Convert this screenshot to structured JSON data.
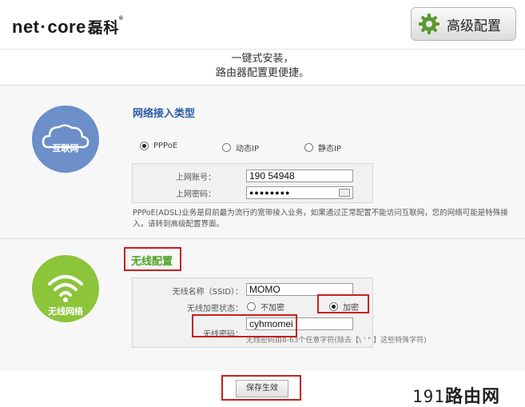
{
  "header": {
    "brand_en": "net",
    "brand_dot": "·",
    "brand_en2": "core",
    "brand_cn": "磊科",
    "brand_reg": "®",
    "advanced_label": "高级配置"
  },
  "slogan": {
    "line1": "一键式安装，",
    "line2": "路由器配置更便捷。"
  },
  "internet": {
    "icon_label": "互联网",
    "title": "网络接入类型",
    "options": [
      "PPPoE",
      "动态IP",
      "静态IP"
    ],
    "selected": "PPPoE",
    "account_label": "上网账号：",
    "account_value": "190     54948",
    "password_label": "上网密码：",
    "password_value": "●●●●●●●●",
    "description": "PPPoE(ADSL)业务是目前最为流行的宽带接入业务，如果通过正常配置不能访问互联网，您的网络可能是特殊接入，请转到高级配置界面。"
  },
  "wireless": {
    "icon_label": "无线网络",
    "title": "无线配置",
    "ssid_label": "无线名称（SSID）：",
    "ssid_value": "MOMO",
    "encrypt_label": "无线加密状态：",
    "enc_options": [
      "不加密",
      "加密"
    ],
    "enc_selected": "加密",
    "password_label": "无线密码：",
    "password_value": "cyhmomei",
    "password_hint": "无线密码由8-63个任意字符(除去【\\ ' \" 】这些特殊字符)"
  },
  "footer": {
    "save_label": "保存生效",
    "watermark_num": "191",
    "watermark_text": "路由网"
  },
  "colors": {
    "internet_circle": "#6c8fc9",
    "wireless_circle": "#8cc43a",
    "highlight": "#c81e1e",
    "title_blue": "#2a5caa",
    "title_green": "#4ca220"
  }
}
